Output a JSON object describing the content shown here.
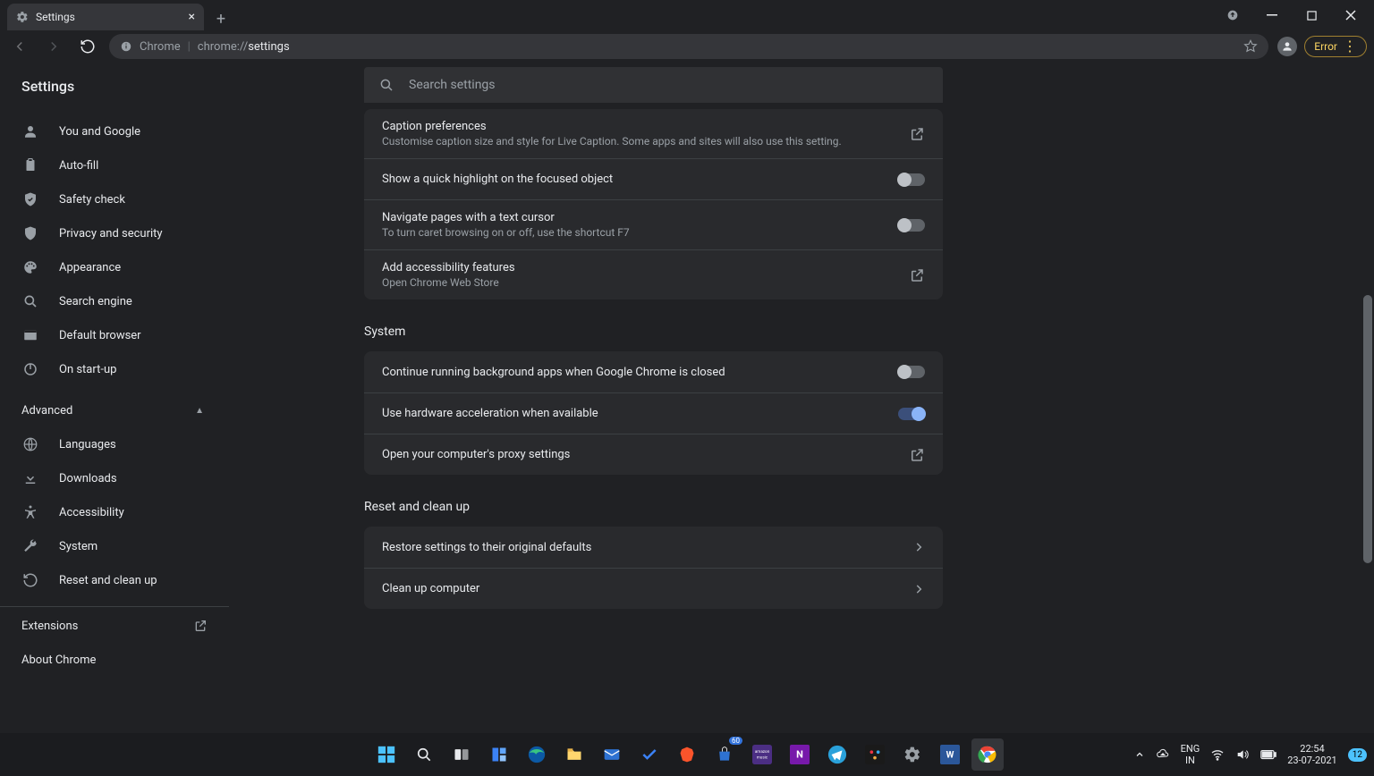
{
  "tab": {
    "title": "Settings"
  },
  "omnibox": {
    "scheme": "Chrome",
    "path_dim": "chrome://",
    "path_bright": "settings"
  },
  "toolbar": {
    "error_label": "Error"
  },
  "page": {
    "title": "Settings"
  },
  "search": {
    "placeholder": "Search settings"
  },
  "sidebar": {
    "primary": [
      {
        "label": "You and Google"
      },
      {
        "label": "Auto-fill"
      },
      {
        "label": "Safety check"
      },
      {
        "label": "Privacy and security"
      },
      {
        "label": "Appearance"
      },
      {
        "label": "Search engine"
      },
      {
        "label": "Default browser"
      },
      {
        "label": "On start-up"
      }
    ],
    "advanced_label": "Advanced",
    "advanced": [
      {
        "label": "Languages"
      },
      {
        "label": "Downloads"
      },
      {
        "label": "Accessibility"
      },
      {
        "label": "System"
      },
      {
        "label": "Reset and clean up"
      }
    ],
    "extensions_label": "Extensions",
    "about_label": "About Chrome"
  },
  "panel": {
    "accessibility": [
      {
        "title": "Caption preferences",
        "sub": "Customise caption size and style for Live Caption. Some apps and sites will also use this setting.",
        "action": "launch"
      },
      {
        "title": "Show a quick highlight on the focused object",
        "action": "toggle",
        "on": false
      },
      {
        "title": "Navigate pages with a text cursor",
        "sub": "To turn caret browsing on or off, use the shortcut F7",
        "action": "toggle",
        "on": false
      },
      {
        "title": "Add accessibility features",
        "sub": "Open Chrome Web Store",
        "action": "launch"
      }
    ],
    "system_label": "System",
    "system": [
      {
        "title": "Continue running background apps when Google Chrome is closed",
        "action": "toggle",
        "on": false
      },
      {
        "title": "Use hardware acceleration when available",
        "action": "toggle",
        "on": true
      },
      {
        "title": "Open your computer's proxy settings",
        "action": "launch"
      }
    ],
    "reset_label": "Reset and clean up",
    "reset": [
      {
        "title": "Restore settings to their original defaults",
        "action": "chevron"
      },
      {
        "title": "Clean up computer",
        "action": "chevron"
      }
    ]
  },
  "taskbar": {
    "lang1": "ENG",
    "lang2": "IN",
    "time": "22:54",
    "date": "23-07-2021",
    "notif_count": "12",
    "mail_badge": "60"
  }
}
